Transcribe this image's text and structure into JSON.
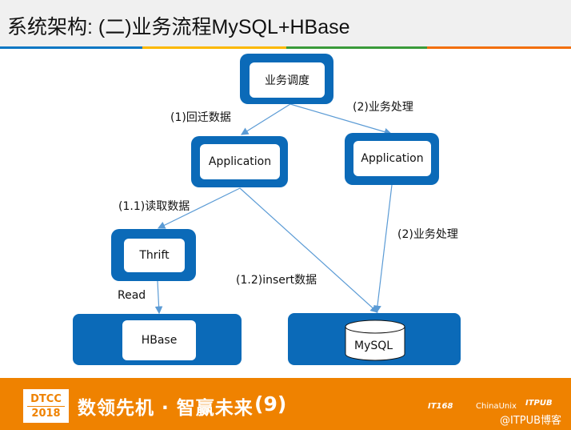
{
  "header": {
    "title": "系统架构: (二)业务流程MySQL+HBase",
    "stripe_colors": [
      "#0b77c4",
      "#fbb800",
      "#3a9b3a",
      "#f26f0c"
    ]
  },
  "diagram": {
    "box_color": "#0b6ab8",
    "nodes": {
      "scheduler": "业务调度",
      "app_left": "Application",
      "app_right": "Application",
      "thrift": "Thrift",
      "hbase": "HBase",
      "mysql": "MySQL"
    },
    "edges": {
      "back_migrate": "(1)回迁数据",
      "business_top": "(2)业务处理",
      "read_data": "(1.1)读取数据",
      "business_right": "(2)业务处理",
      "insert_data": "(1.2)insert数据",
      "read": "Read"
    }
  },
  "footer": {
    "bg": "#ef8200",
    "logo_top": "DTCC",
    "logo_year": "2018",
    "slogan": "数领先机 · 智赢未来",
    "edition": "9",
    "sponsors": [
      "IT168",
      "ChinaUnix",
      "ITPUB"
    ],
    "credit": "@ITPUB博客"
  }
}
